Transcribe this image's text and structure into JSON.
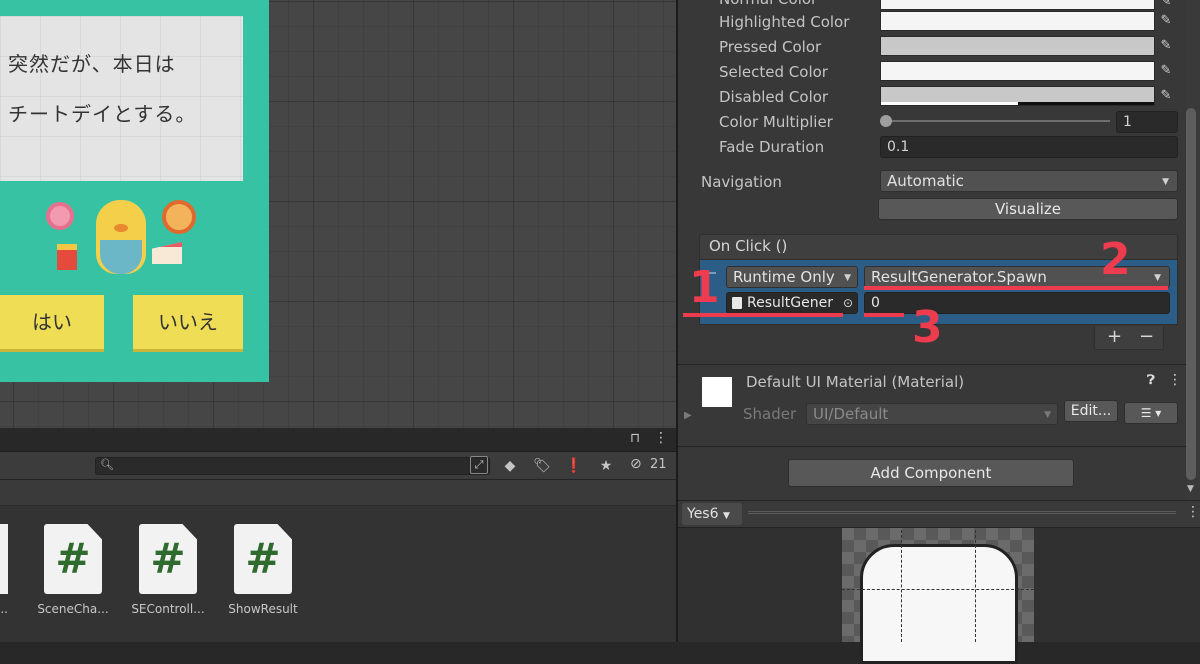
{
  "game": {
    "line1": "突然だが、本日は",
    "line2": "チートデイとする。",
    "yes_label": "はい",
    "no_label": "いいえ"
  },
  "inspector": {
    "normal_color_label": "Normal Color",
    "highlighted_color_label": "Highlighted Color",
    "pressed_color_label": "Pressed Color",
    "selected_color_label": "Selected Color",
    "disabled_color_label": "Disabled Color",
    "color_multiplier_label": "Color Multiplier",
    "color_multiplier_value": "1",
    "color_multiplier_slider": 0.0,
    "fade_duration_label": "Fade Duration",
    "fade_duration_value": "0.1",
    "navigation_label": "Navigation",
    "navigation_value": "Automatic",
    "visualize_label": "Visualize",
    "onclick_label": "On Click ()",
    "runtime_value": "Runtime Only",
    "function_value": "ResultGenerator.Spawn",
    "target_object": "ResultGener",
    "argument_value": "0",
    "plus_label": "+",
    "minus_label": "−",
    "material_name": "Default UI Material (Material)",
    "shader_label": "Shader",
    "shader_value": "UI/Default",
    "edit_label": "Edit...",
    "add_component_label": "Add Component"
  },
  "annotations": {
    "mark1": "1",
    "mark2": "2",
    "mark3": "3",
    "color": "#ec3c4e"
  },
  "project": {
    "search_value": "",
    "hidden_count": "21",
    "assets": [
      {
        "name": "e...",
        "icon": "csharp-script-icon"
      },
      {
        "name": "SceneCha...",
        "icon": "csharp-script-icon"
      },
      {
        "name": "SEControll...",
        "icon": "csharp-script-icon"
      },
      {
        "name": "ShowResult",
        "icon": "csharp-script-icon"
      }
    ],
    "hash_glyph": "#"
  },
  "preview": {
    "name": "Yes6"
  }
}
